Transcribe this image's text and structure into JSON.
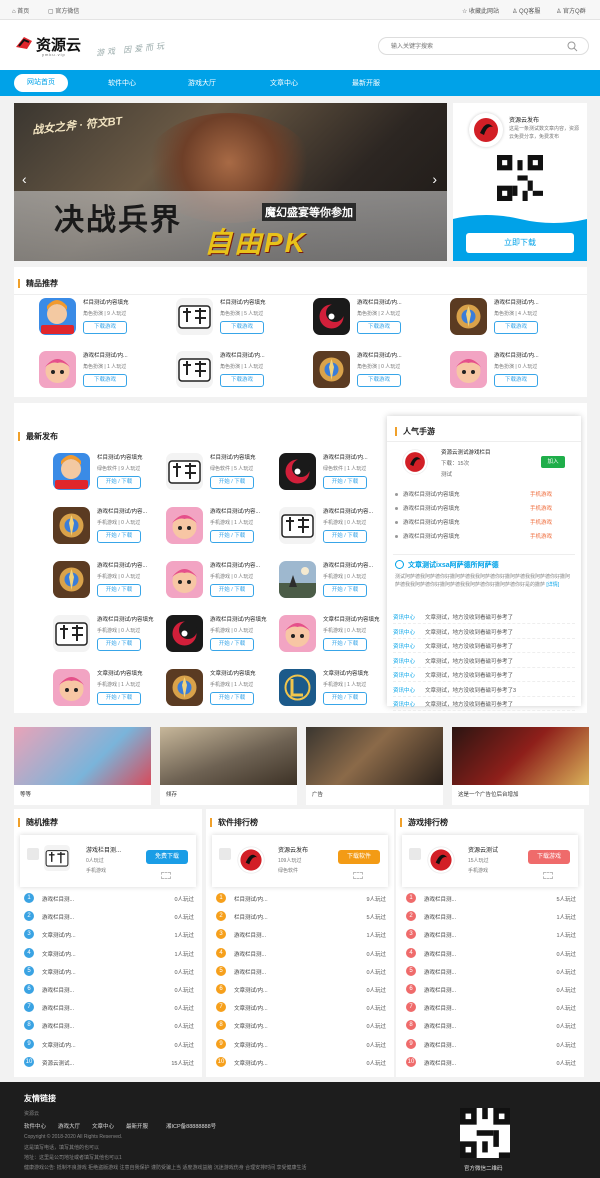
{
  "topbar": {
    "home": "首页",
    "wechat": "官方微信",
    "bookmark": "收藏此网站",
    "qq_service": "QQ客服",
    "qq_group": "官方Q群"
  },
  "header": {
    "logo_text": "资源云",
    "logo_sub": "ymku.vip",
    "slogan": "游戏 因爱而玩",
    "search_placeholder": "输入关键字搜索"
  },
  "nav": {
    "items": [
      "网站首页",
      "软件中心",
      "游戏大厅",
      "文章中心",
      "最新开服"
    ]
  },
  "banner": {
    "title": "战女之斧 · 符文BT",
    "headline": "决战兵界",
    "sub": "魔幻盛宴等你参加",
    "pk": "自由PK"
  },
  "promo": {
    "name": "资源云发布",
    "desc": "这是一条测试数文章内容，资源云免费分享，免费发布",
    "download": "立即下载"
  },
  "featured": {
    "title": "精品推荐",
    "download": "下载游戏",
    "items": [
      {
        "name": "栏目测试/内容填充",
        "meta": "角色扮演 | 9 人玩过",
        "icon": "chibi"
      },
      {
        "name": "栏目测试/内容填充",
        "meta": "角色扮演 | 5 人玩过",
        "icon": "lingzhi"
      },
      {
        "name": "游戏栏目测试/内...",
        "meta": "角色扮演 | 2 人玩过",
        "icon": "moon"
      },
      {
        "name": "游戏栏目测试/内...",
        "meta": "角色扮演 | 4 人玩过",
        "icon": "hearth"
      },
      {
        "name": "游戏栏目测试/内...",
        "meta": "角色扮演 | 1 人玩过",
        "icon": "pink"
      },
      {
        "name": "游戏栏目测试/内...",
        "meta": "角色扮演 | 1 人玩过",
        "icon": "lingzhi"
      },
      {
        "name": "游戏栏目测试/内...",
        "meta": "角色扮演 | 0 人玩过",
        "icon": "hearth"
      },
      {
        "name": "游戏栏目测试/内...",
        "meta": "角色扮演 | 0 人玩过",
        "icon": "pink"
      }
    ]
  },
  "latest": {
    "title": "最新发布",
    "btn": "开始 / 下载",
    "items": [
      {
        "name": "栏目测试/内容填充",
        "meta": "绿色软件 | 9 人玩过",
        "icon": "chibi"
      },
      {
        "name": "栏目测试/内容填充",
        "meta": "绿色软件 | 5 人玩过",
        "icon": "lingzhi"
      },
      {
        "name": "游戏栏目测试/内...",
        "meta": "绿色软件 | 1 人玩过",
        "icon": "moon"
      },
      {
        "name": "游戏栏目测试/内容...",
        "meta": "手机游戏 | 0 人玩过",
        "icon": "hearth"
      },
      {
        "name": "游戏栏目测试/内容...",
        "meta": "手机游戏 | 1 人玩过",
        "icon": "pink"
      },
      {
        "name": "游戏栏目测试/内容...",
        "meta": "手机游戏 | 0 人玩过",
        "icon": "lingzhi"
      },
      {
        "name": "游戏栏目测试/内容...",
        "meta": "手机游戏 | 0 人玩过",
        "icon": "hearth"
      },
      {
        "name": "游戏栏目测试/内容...",
        "meta": "手机游戏 | 0 人玩过",
        "icon": "pink"
      },
      {
        "name": "游戏栏目测试/内容...",
        "meta": "手机游戏 | 0 人玩过",
        "icon": "scene"
      },
      {
        "name": "游戏栏目测试/内容填充",
        "meta": "手机游戏 | 0 人玩过",
        "icon": "lingzhi"
      },
      {
        "name": "游戏栏目测试/内容填充",
        "meta": "手机游戏 | 0 人玩过",
        "icon": "moon"
      },
      {
        "name": "文章栏目测试/内容填充",
        "meta": "手机游戏 | 0 人玩过",
        "icon": "pink"
      },
      {
        "name": "文章测试/内容填充",
        "meta": "手机游戏 | 1 人玩过",
        "icon": "pink"
      },
      {
        "name": "文章测试/内容填充",
        "meta": "手机游戏 | 1 人玩过",
        "icon": "hearth"
      },
      {
        "name": "文章测试/内容填充",
        "meta": "手机游戏 | 1 人玩过",
        "icon": "lol"
      }
    ]
  },
  "hot": {
    "title": "人气手游",
    "top_name": "资源云测试游戏栏目",
    "top_dl": "下载：15次",
    "top_cat": "测试",
    "top_btn": "加入",
    "items": [
      {
        "t": "游戏栏目测试/内容填充",
        "c": "手机游戏"
      },
      {
        "t": "游戏栏目测试/内容填充",
        "c": "手机游戏"
      },
      {
        "t": "游戏栏目测试/内容填充",
        "c": "手机游戏"
      },
      {
        "t": "游戏栏目测试/内容填充",
        "c": "手机游戏"
      }
    ],
    "article_title": "文章测试ixsa阿萨德所阿萨德",
    "article_body": "测试阿萨德我阿萨德你好撒阿萨德我我阿萨德你好撒阿萨德我我阿萨德你好撒阿萨德我我阿萨德你好撒阿萨德我我阿萨德你好撒阿萨德你好是的撒萨",
    "article_more": "[详情]",
    "news": [
      {
        "tag": "资讯中心",
        "t": "文章测试，地方没收到看磁可参考了"
      },
      {
        "tag": "资讯中心",
        "t": "文章测试，地方没收到看磁可参考了"
      },
      {
        "tag": "资讯中心",
        "t": "文章测试，地方没收到看磁可参考了"
      },
      {
        "tag": "资讯中心",
        "t": "文章测试，地方没收到看磁可参考了"
      },
      {
        "tag": "资讯中心",
        "t": "文章测试，地方没收到看磁可参考了"
      },
      {
        "tag": "资讯中心",
        "t": "文章测试，地方没收到看磁可参考了3"
      },
      {
        "tag": "资讯中心",
        "t": "文章测试，地方没收到看磁可参考了"
      }
    ]
  },
  "ads": [
    {
      "cap": "等等"
    },
    {
      "cap": "倾存"
    },
    {
      "cap": "广告"
    },
    {
      "cap": "这是一个广告位后台增加"
    }
  ],
  "rank_random": {
    "title": "随机推荐",
    "top_name": "游戏栏目测...",
    "top_meta1": "0人玩过",
    "top_meta2": "手机游戏",
    "btn": "免费下载",
    "rows": [
      {
        "t": "游戏栏目测...",
        "c": "0人玩过"
      },
      {
        "t": "游戏栏目测...",
        "c": "0人玩过"
      },
      {
        "t": "文章测试/内...",
        "c": "1人玩过"
      },
      {
        "t": "文章测试/内...",
        "c": "1人玩过"
      },
      {
        "t": "文章测试/内...",
        "c": "0人玩过"
      },
      {
        "t": "游戏栏目测...",
        "c": "0人玩过"
      },
      {
        "t": "游戏栏目测...",
        "c": "0人玩过"
      },
      {
        "t": "游戏栏目测...",
        "c": "0人玩过"
      },
      {
        "t": "文章测试/内...",
        "c": "0人玩过"
      },
      {
        "t": "资源云测试...",
        "c": "15人玩过"
      }
    ]
  },
  "rank_soft": {
    "title": "软件排行榜",
    "top_name": "资源云发布",
    "top_meta1": "109人玩过",
    "top_meta2": "绿色软件",
    "btn": "下载软件",
    "rows": [
      {
        "t": "栏目测试/内...",
        "c": "9人玩过"
      },
      {
        "t": "栏目测试/内...",
        "c": "5人玩过"
      },
      {
        "t": "游戏栏目测...",
        "c": "1人玩过"
      },
      {
        "t": "游戏栏目测...",
        "c": "0人玩过"
      },
      {
        "t": "游戏栏目测...",
        "c": "0人玩过"
      },
      {
        "t": "文章测试/内...",
        "c": "0人玩过"
      },
      {
        "t": "文章测试/内...",
        "c": "0人玩过"
      },
      {
        "t": "文章测试/内...",
        "c": "0人玩过"
      },
      {
        "t": "文章测试/内...",
        "c": "0人玩过"
      },
      {
        "t": "文章测试/内...",
        "c": "0人玩过"
      }
    ]
  },
  "rank_game": {
    "title": "游戏排行榜",
    "top_name": "资源云测试",
    "top_meta1": "15人玩过",
    "top_meta2": "手机游戏",
    "btn": "下载游戏",
    "rows": [
      {
        "t": "游戏栏目测...",
        "c": "5人玩过"
      },
      {
        "t": "游戏栏目测...",
        "c": "1人玩过"
      },
      {
        "t": "游戏栏目测...",
        "c": "1人玩过"
      },
      {
        "t": "游戏栏目测...",
        "c": "0人玩过"
      },
      {
        "t": "游戏栏目测...",
        "c": "0人玩过"
      },
      {
        "t": "游戏栏目测...",
        "c": "0人玩过"
      },
      {
        "t": "游戏栏目测...",
        "c": "0人玩过"
      },
      {
        "t": "游戏栏目测...",
        "c": "0人玩过"
      },
      {
        "t": "游戏栏目测...",
        "c": "0人玩过"
      },
      {
        "t": "游戏栏目测...",
        "c": "0人玩过"
      }
    ]
  },
  "footer": {
    "title": "友情链接",
    "site": "资源云",
    "links": [
      "软件中心",
      "游戏大厅",
      "文章中心",
      "最新开服",
      "湘ICP备88888888号"
    ],
    "copy": "Copyright © 2018-2020  All Rights Reserved.",
    "l1": "这是填写电话，填写其他的也可以",
    "l2": "地址：这里是公司地址或者填写其他也可以1",
    "l3": "健康游戏公告: 抵制不良游戏 拒绝盗版游戏 注意自我保护 谨防受骗上当 适度游戏益脑 沉迷游戏伤身 合理安排时间 享受健康生活",
    "qr_caption": "官方微信二维码"
  },
  "colors": {
    "accent": "#00a2e8",
    "orange": "#f0a02a",
    "rank_blue": "#3aa3e3",
    "rank_orange": "#f6a01c",
    "rank_red": "#ef6b6b"
  }
}
